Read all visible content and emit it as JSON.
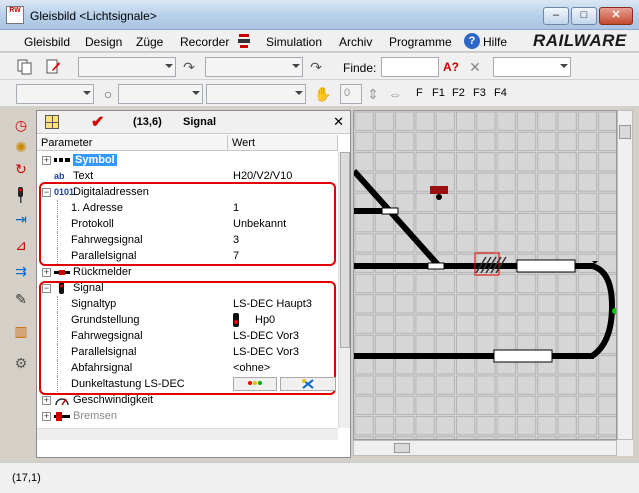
{
  "window": {
    "title": "Gleisbild <Lichtsignale>",
    "app_icon_text": "RW",
    "min_label": "–",
    "max_label": "□",
    "close_label": "✕"
  },
  "menu": {
    "items": [
      "Gleisbild",
      "Design",
      "Züge",
      "Recorder",
      "Simulation",
      "Archiv",
      "Programme",
      "Hilfe"
    ],
    "brand": "RAILWARE"
  },
  "toolbar": {
    "find_label": "Finde:",
    "find_value": "",
    "combo_values": [
      "",
      "",
      "",
      "",
      "",
      ""
    ],
    "spin_value": "0",
    "fkeys": [
      "F",
      "F1",
      "F2",
      "F3",
      "F4"
    ]
  },
  "panel": {
    "coords": "(13,6)",
    "title": "Signal",
    "col_param": "Parameter",
    "col_value": "Wert",
    "rows": [
      {
        "name": "Symbol",
        "value": "",
        "kind": "sel",
        "icon": "symbol-icon"
      },
      {
        "name": "Text",
        "value": "H20/V2/V10",
        "kind": "leaf-top",
        "icon": "text-icon",
        "icon_text": "ab"
      },
      {
        "name": "Digitaladressen",
        "value": "",
        "kind": "cat",
        "icon": "binary-icon",
        "icon_text": "0101"
      },
      {
        "name": "1. Adresse",
        "value": "1",
        "kind": "child"
      },
      {
        "name": "Protokoll",
        "value": "Unbekannt",
        "kind": "child"
      },
      {
        "name": "Fahrwegsignal",
        "value": "3",
        "kind": "child"
      },
      {
        "name": "Parallelsignal",
        "value": "7",
        "kind": "child"
      },
      {
        "name": "Rückmelder",
        "value": "",
        "kind": "cat",
        "icon": "feedback-icon"
      },
      {
        "name": "Signal",
        "value": "",
        "kind": "cat",
        "icon": "signal-icon"
      },
      {
        "name": "Signaltyp",
        "value": "LS-DEC Haupt3",
        "kind": "child"
      },
      {
        "name": "Grundstellung",
        "value": "Hp0",
        "kind": "child"
      },
      {
        "name": "Fahrwegsignal",
        "value": "LS-DEC Vor3",
        "kind": "child"
      },
      {
        "name": "Parallelsignal",
        "value": "LS-DEC Vor3",
        "kind": "child"
      },
      {
        "name": "Abfahrsignal",
        "value": "<ohne>",
        "kind": "child"
      },
      {
        "name": "Dunkeltastung LS-DEC",
        "value": "",
        "kind": "child"
      },
      {
        "name": "Geschwindigkeit",
        "value": "",
        "kind": "cat",
        "icon": "speedometer-icon"
      },
      {
        "name": "Bremsen",
        "value": "",
        "kind": "cat-dim",
        "icon": "brake-icon"
      }
    ]
  },
  "status": {
    "text": "(17,1)"
  },
  "colors": {
    "selection": "#3399ff",
    "highlight_box": "#e00000",
    "track": "#000000",
    "grid_cell": "#d6d6d6",
    "grid_line": "#b4b4b4"
  }
}
